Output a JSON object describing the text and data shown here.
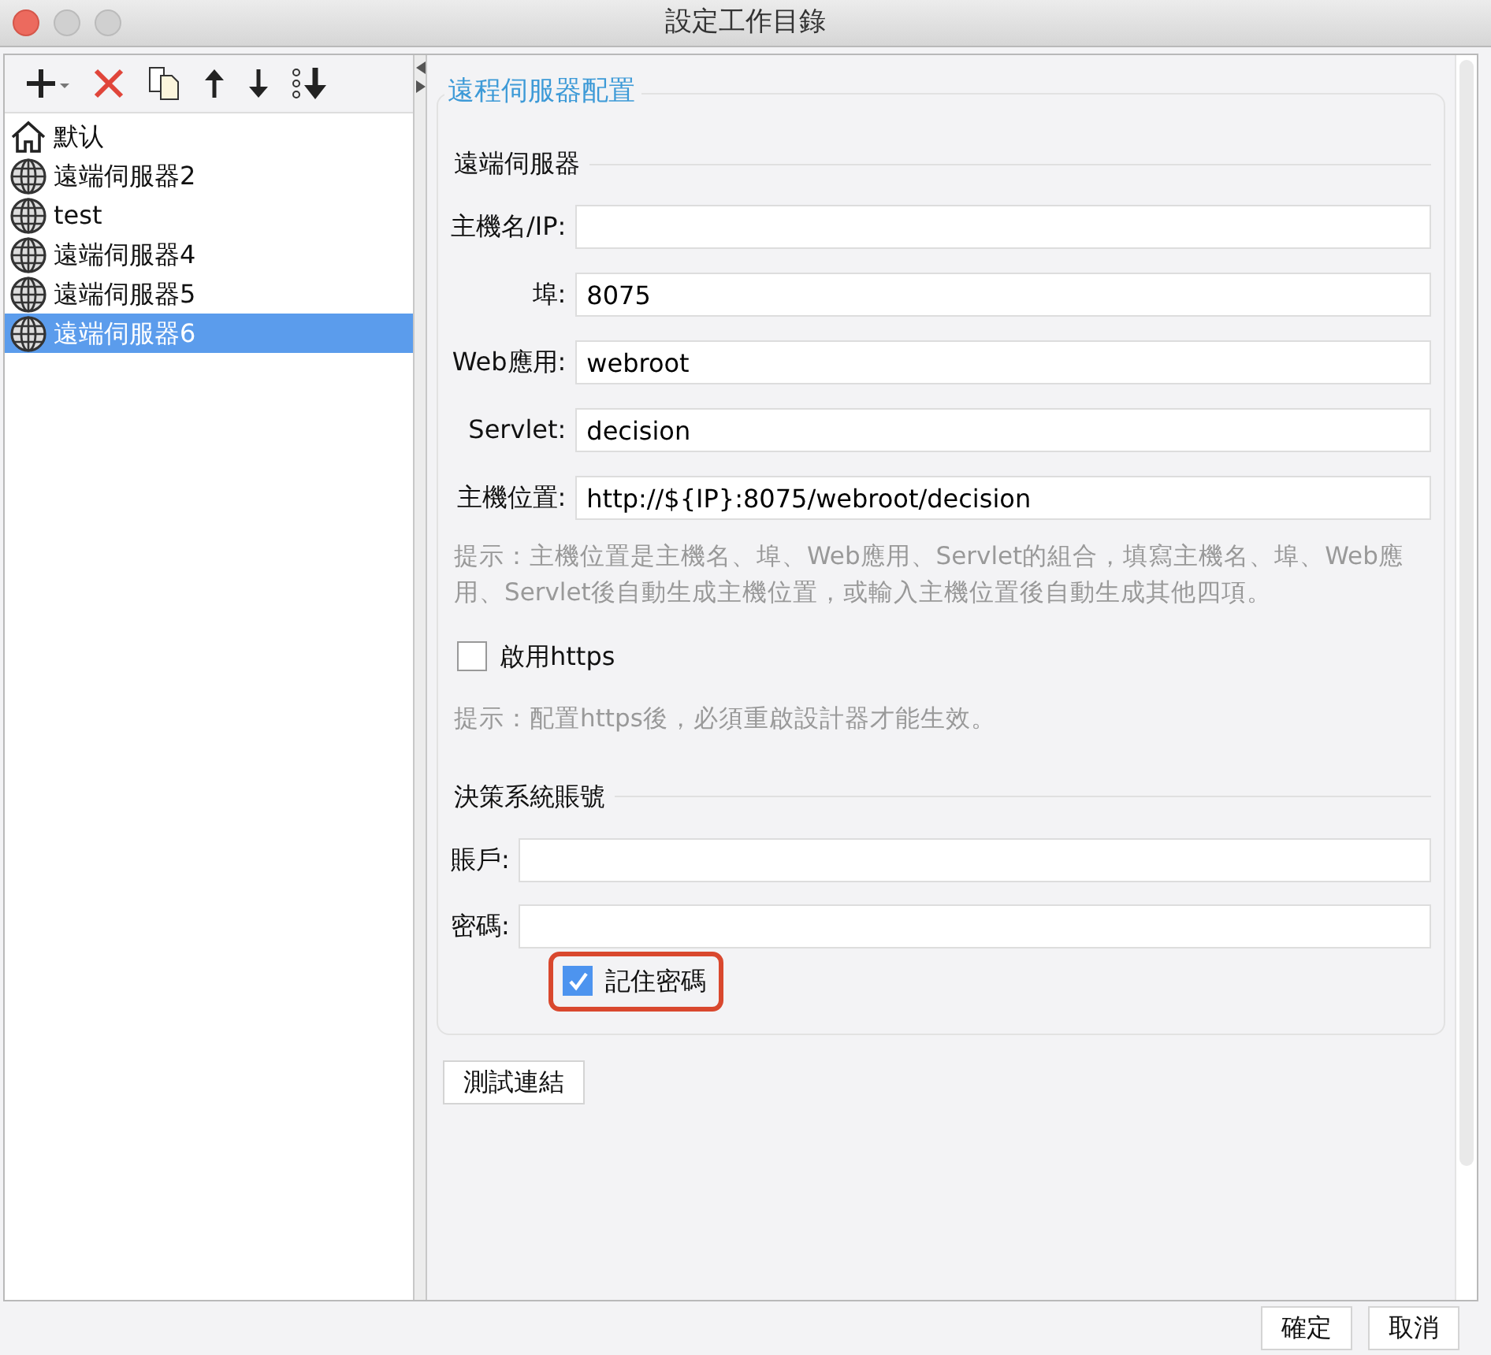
{
  "window": {
    "title": "設定工作目錄"
  },
  "servers": [
    {
      "kind": "home",
      "label": "默认",
      "selected": false
    },
    {
      "kind": "server",
      "label": "遠端伺服器2",
      "selected": false
    },
    {
      "kind": "server",
      "label": "test",
      "selected": false
    },
    {
      "kind": "server",
      "label": "遠端伺服器4",
      "selected": false
    },
    {
      "kind": "server",
      "label": "遠端伺服器5",
      "selected": false
    },
    {
      "kind": "server",
      "label": "遠端伺服器6",
      "selected": true
    }
  ],
  "panel": {
    "title": "遠程伺服器配置",
    "server_section": {
      "title": "遠端伺服器",
      "fields": [
        {
          "label": "主機名/IP:"
        },
        {
          "label": "埠:",
          "value": "8075"
        },
        {
          "label": "Web應用:",
          "value": "webroot"
        },
        {
          "label": "Servlet:",
          "value": "decision"
        },
        {
          "label": "主機位置:",
          "value": "http://${IP}:8075/webroot/decision"
        }
      ]
    },
    "hint": "提示：主機位置是主機名、埠、Web應用、Servlet的組合，填寫主機名、埠、Web應用、Servlet後自動生成主機位置，或輸入主機位置後自動生成其他四項。",
    "https": {
      "label": "啟用https",
      "checked": false
    },
    "https_hint": "提示：配置https後，必須重啟設計器才能生效。",
    "account_section": {
      "title": "決策系統賬號",
      "fields": [
        {
          "label": "賬戶:"
        },
        {
          "label": "密碼:"
        }
      ],
      "remember": {
        "label": "記住密碼",
        "checked": true,
        "highlighted": true
      }
    },
    "test_button": "測試連結"
  },
  "buttons": [
    "確定",
    "取消"
  ]
}
